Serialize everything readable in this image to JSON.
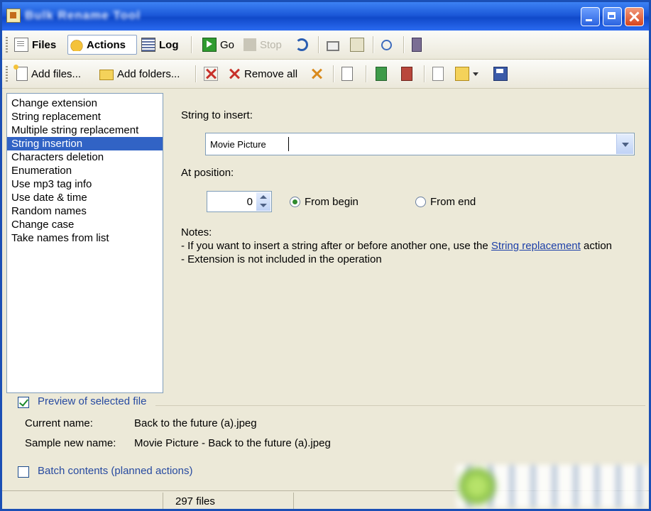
{
  "window": {
    "title": "Bulk Rename Tool"
  },
  "toolbar1": {
    "files": "Files",
    "actions": "Actions",
    "log": "Log",
    "go": "Go",
    "stop": "Stop"
  },
  "toolbar2": {
    "add_files": "Add files...",
    "add_folders": "Add folders...",
    "remove_all": "Remove all"
  },
  "actions_list": {
    "items": [
      "Change extension",
      "String replacement",
      "Multiple string replacement",
      "String insertion",
      "Characters deletion",
      "Enumeration",
      "Use mp3 tag info",
      "Use date & time",
      "Random names",
      "Change case",
      "Take names from list"
    ],
    "selected": "String insertion"
  },
  "insertion": {
    "string_label": "String to insert:",
    "string_value": "Movie Picture",
    "position_label": "At position:",
    "position_value": "0",
    "from_begin": "From begin",
    "from_end": "From end",
    "notes_label": "Notes:",
    "note1_prefix": "- If you want to insert a string after or before another one, use the",
    "note1_link": "String replacement",
    "note1_suffix": "action",
    "note2": "- Extension is not included in the operation"
  },
  "preview": {
    "title": "Preview of selected file",
    "checked": true,
    "current_label": "Current name:",
    "current_value": "Back to the future (a).jpeg",
    "sample_label": "Sample new name:",
    "sample_value": "Movie Picture - Back to the future (a).jpeg"
  },
  "batch": {
    "title": "Batch contents (planned actions)",
    "checked": false
  },
  "status": {
    "count": "297 files"
  }
}
